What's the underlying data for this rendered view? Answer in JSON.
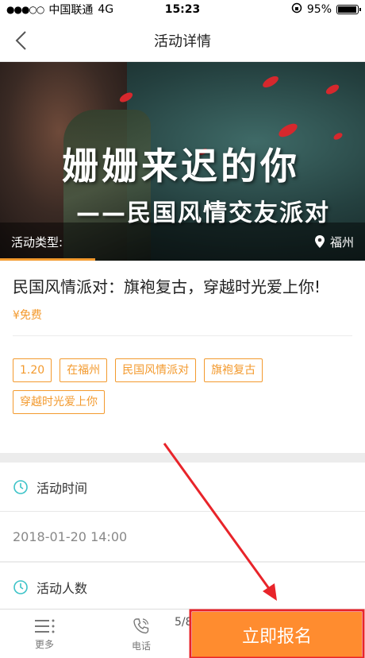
{
  "status_bar": {
    "carrier": "中国联通",
    "network": "4G",
    "time": "15:23",
    "battery": "95%",
    "battery_level": 0.95
  },
  "nav": {
    "title": "活动详情"
  },
  "hero": {
    "headline": "姗姗来迟的你",
    "subheadline": "——民国风情交友派对",
    "type_label": "活动类型:",
    "location": "福州"
  },
  "event": {
    "name": "民国风情派对：旗袍复古，穿越时光爱上你!",
    "price": "¥免费",
    "tags": [
      "1.20",
      "在福州",
      "民国风情派对",
      "旗袍复古",
      "穿越时光爱上你"
    ]
  },
  "sections": {
    "time": {
      "title": "活动时间",
      "value": "2018-01-20 14:00"
    },
    "people": {
      "title": "活动人数"
    }
  },
  "bottom_bar": {
    "more": "更多",
    "phone": "电话",
    "page_indicator": "5/8",
    "signup": "立即报名"
  },
  "colors": {
    "accent": "#f39a2e",
    "signup_bg": "#ff8c2f",
    "teal_icon": "#3cc3c8",
    "annotation_arrow": "#e8242a"
  }
}
